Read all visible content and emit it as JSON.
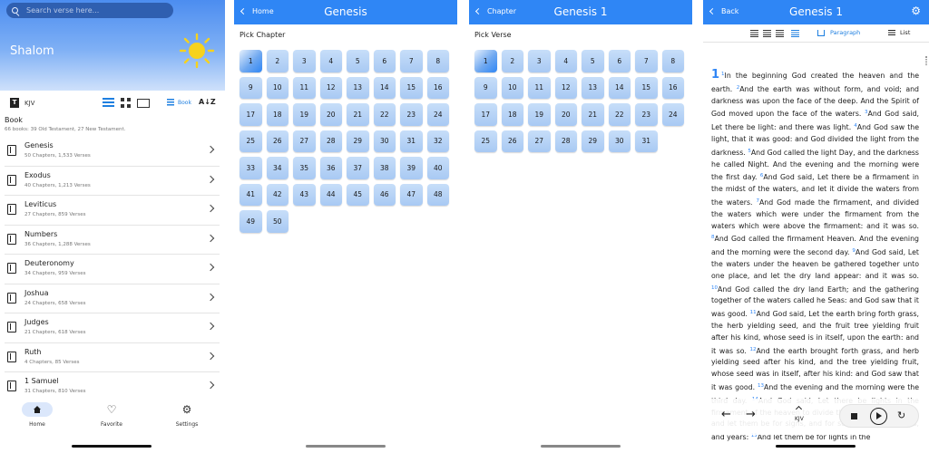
{
  "home": {
    "search_placeholder": "Search verse here...",
    "greeting": "Shalom",
    "version": "KJV",
    "sort_label": "Book",
    "sort_az": "A↓Z",
    "section_title": "Book",
    "section_sub": "66 books: 39 Old Testament, 27 New Testament.",
    "books": [
      {
        "name": "Genesis",
        "detail": "50 Chapters, 1,533 Verses"
      },
      {
        "name": "Exodus",
        "detail": "40 Chapters, 1,213 Verses"
      },
      {
        "name": "Leviticus",
        "detail": "27 Chapters, 859 Verses"
      },
      {
        "name": "Numbers",
        "detail": "36 Chapters, 1,288 Verses"
      },
      {
        "name": "Deuteronomy",
        "detail": "34 Chapters, 959 Verses"
      },
      {
        "name": "Joshua",
        "detail": "24 Chapters, 658 Verses"
      },
      {
        "name": "Judges",
        "detail": "21 Chapters, 618 Verses"
      },
      {
        "name": "Ruth",
        "detail": "4 Chapters, 85 Verses"
      },
      {
        "name": "1 Samuel",
        "detail": "31 Chapters, 810 Verses"
      }
    ],
    "nav": {
      "home": "Home",
      "favorite": "Favorite",
      "settings": "Settings"
    }
  },
  "chapters": {
    "back_label": "Home",
    "title": "Genesis",
    "pick_label": "Pick Chapter",
    "count": 50,
    "selected": 1
  },
  "verses": {
    "back_label": "Chapter",
    "title": "Genesis 1",
    "pick_label": "Pick Verse",
    "count": 31,
    "selected": 1
  },
  "reader": {
    "back_label": "Back",
    "title": "Genesis 1",
    "mode_paragraph": "Paragraph",
    "mode_list": "List",
    "chapter_number": "1",
    "verses": [
      {
        "n": "1",
        "t": "In the beginning God created the heaven and the earth."
      },
      {
        "n": "2",
        "t": "And the earth was without form, and void; and darkness was upon the face of the deep. And the Spirit of God moved upon the face of the waters."
      },
      {
        "n": "3",
        "t": "And God said, Let there be light: and there was light."
      },
      {
        "n": "4",
        "t": "And God saw the light, that it was good: and God divided the light from the darkness."
      },
      {
        "n": "5",
        "t": "And God called the light Day, and the darkness he called Night. And the evening and the morning were the first day."
      },
      {
        "n": "6",
        "t": "And God said, Let there be a firmament in the midst of the waters, and let it divide the waters from the waters."
      },
      {
        "n": "7",
        "t": "And God made the firmament, and divided the waters which were under the firmament from the waters which were above the firmament: and it was so."
      },
      {
        "n": "8",
        "t": "And God called the firmament Heaven. And the evening and the morning were the second day."
      },
      {
        "n": "9",
        "t": "And God said, Let the waters under the heaven be gathered together unto one place, and let the dry land appear: and it was so."
      },
      {
        "n": "10",
        "t": "And God called the dry land Earth; and the gathering together of the waters called he Seas: and God saw that it was good."
      },
      {
        "n": "11",
        "t": "And God said, Let the earth bring forth grass, the herb yielding seed, and the fruit tree yielding fruit after his kind, whose seed is in itself, upon the earth: and it was so."
      },
      {
        "n": "12",
        "t": "And the earth brought forth grass, and herb yielding seed after his kind, and the tree yielding fruit, whose seed was in itself, after his kind: and God saw that it was good."
      },
      {
        "n": "13",
        "t": "And the evening and the morning were the third day."
      },
      {
        "n": "14",
        "t": "And God said, Let there be lights in the firmament of the heaven to divide the day from the night; and let them be for signs, and for seasons, and for days, and years:"
      },
      {
        "n": "15",
        "t": "And let them be for lights in the"
      }
    ],
    "player_version": "KJV"
  },
  "colors": {
    "accent": "#2f86f5"
  }
}
